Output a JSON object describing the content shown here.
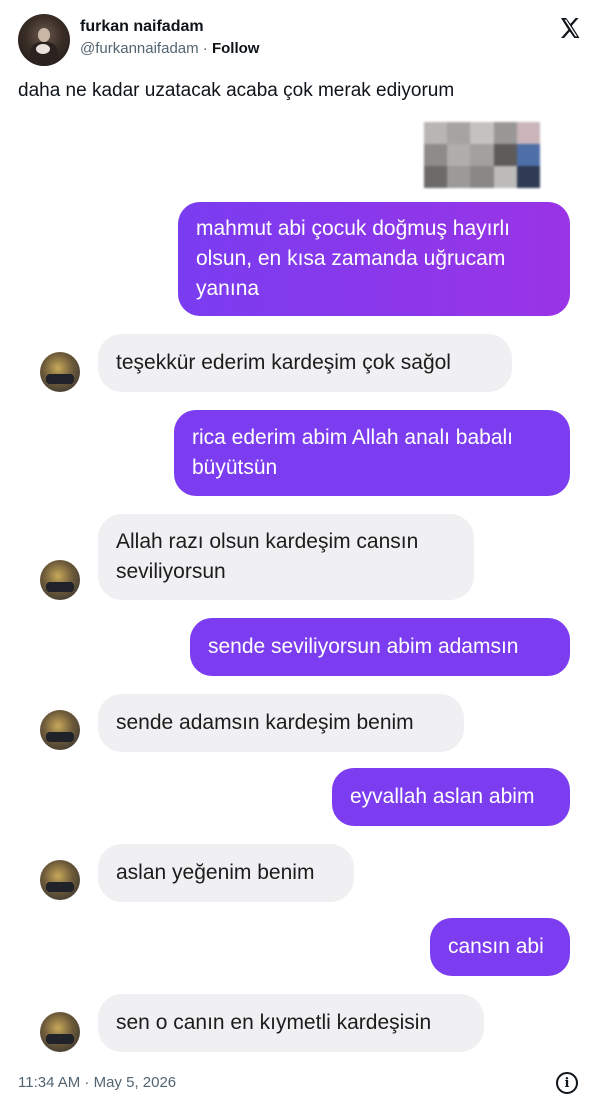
{
  "author": {
    "name": "furkan naifadam",
    "handle": "@furkannaifadam",
    "separator": " · ",
    "follow_label": "Follow"
  },
  "platform_icon": "x-logo-icon",
  "tweet": {
    "text": "daha ne kadar uzatacak acaba çok merak ediyorum",
    "timestamp": "11:34 AM · May 5, 2026",
    "info_icon": "info-icon"
  },
  "messages": [
    {
      "side": "out",
      "text": "mahmut abi çocuk doğmuş hayırlı olsun, en kısa zamanda uğrucam yanına"
    },
    {
      "side": "in",
      "text": "teşekkür ederim kardeşim çok sağol"
    },
    {
      "side": "out",
      "text": "rica ederim abim Allah analı babalı büyütsün"
    },
    {
      "side": "in",
      "text": "Allah razı olsun kardeşim cansın seviliyorsun"
    },
    {
      "side": "out",
      "text": "sende seviliyorsun abim adamsın"
    },
    {
      "side": "in",
      "text": "sende adamsın kardeşim benim"
    },
    {
      "side": "out",
      "text": "eyvallah aslan abim"
    },
    {
      "side": "in",
      "text": "aslan yeğenim benim"
    },
    {
      "side": "out",
      "text": "cansın abi"
    },
    {
      "side": "in",
      "text": "sen o canın en kıymetli kardeşisin"
    }
  ],
  "colors": {
    "outgoing_bubble": "#7c3df0",
    "incoming_bubble": "#f0f0f3",
    "secondary_text": "#536471"
  }
}
